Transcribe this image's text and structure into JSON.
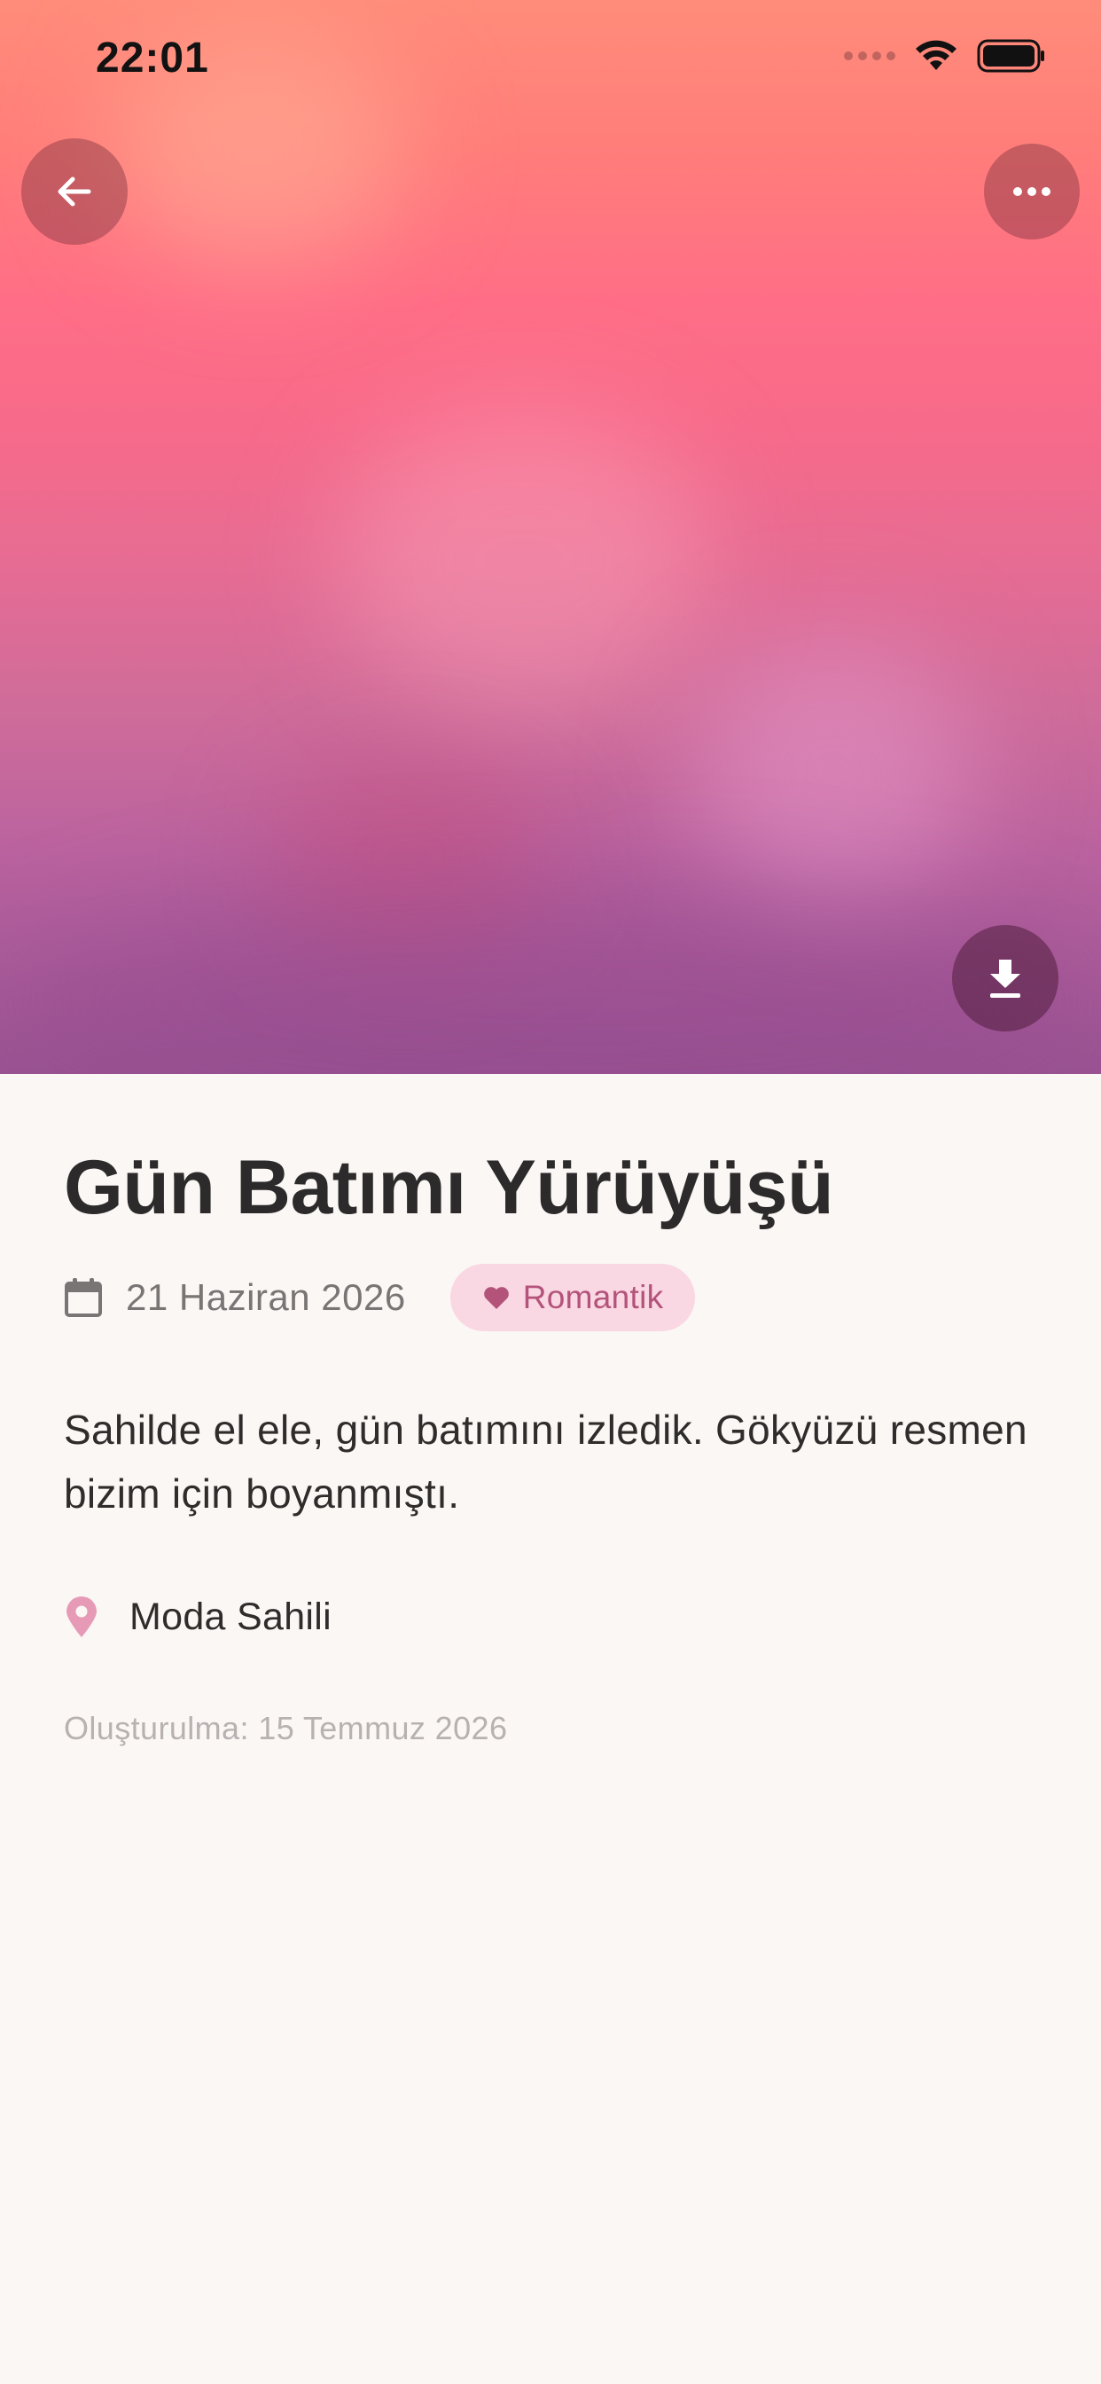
{
  "status_bar": {
    "time": "22:01"
  },
  "memory": {
    "title": "Gün Batımı Yürüyüşü",
    "date": "21 Haziran 2026",
    "tag": "Romantik",
    "description": "Sahilde el ele, gün batımını izledik. Gökyüzü resmen bizim için boyanmıştı.",
    "location": "Moda Sahili",
    "created": "Oluşturulma: 15 Temmuz 2026"
  },
  "icons": {
    "back": "arrow-left-icon",
    "more": "more-horizontal-icon",
    "download": "download-icon",
    "calendar": "calendar-icon",
    "heart": "heart-icon",
    "location": "map-pin-icon"
  },
  "colors": {
    "background": "#fbf7f5",
    "tag_bg": "#f9d7e3",
    "tag_text": "#b4537a",
    "pin": "#e79ab6",
    "button_overlay": "#782d3c"
  }
}
